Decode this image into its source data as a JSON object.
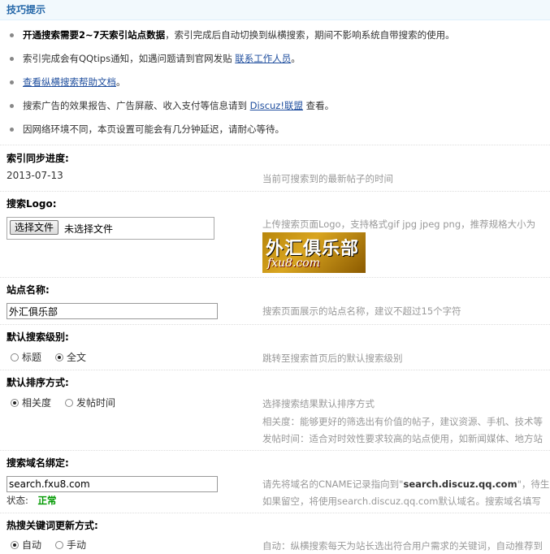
{
  "tips_panel": {
    "title": "技巧提示",
    "items": [
      {
        "bold": "开通搜索需要2~7天索引站点数据",
        "text": "，索引完成后自动切换到纵横搜索，期间不影响系统自带搜索的使用。"
      },
      {
        "text": "索引完成会有QQtips通知，如遇问题请到官网发贴 ",
        "link": "联系工作人员",
        "after": "。"
      },
      {
        "link": "查看纵横搜索帮助文档",
        "after": "。"
      },
      {
        "text": "搜索广告的效果报告、广告屏蔽、收入支付等信息请到 ",
        "link": "Discuz!联盟",
        "after": " 查看。"
      },
      {
        "text": "因网络环境不同，本页设置可能会有几分钟延迟，请耐心等待。"
      }
    ]
  },
  "index_progress": {
    "label": "索引同步进度:",
    "value": "2013-07-13",
    "tip": "当前可搜索到的最新帖子的时间"
  },
  "search_logo": {
    "label": "搜索Logo:",
    "file_button": "选择文件",
    "file_status": "未选择文件",
    "tip": "上传搜索页面Logo，支持格式gif jpg jpeg png，推荐规格大小为",
    "logo_text_cn": "外汇俱乐部",
    "logo_text_en": "fxu8.com"
  },
  "site_name": {
    "label": "站点名称:",
    "value": "外汇俱乐部",
    "tip": "搜索页面展示的站点名称，建议不超过15个字符"
  },
  "default_level": {
    "label": "默认搜索级别:",
    "options": [
      "标题",
      "全文"
    ],
    "selected": "全文",
    "tip": "跳转至搜索首页后的默认搜索级别"
  },
  "default_sort": {
    "label": "默认排序方式:",
    "options": [
      "相关度",
      "发帖时间"
    ],
    "selected": "相关度",
    "tip": "选择搜索结果默认排序方式",
    "tip2": "相关度：能够更好的筛选出有价值的帖子，建议资源、手机、技术等",
    "tip3": "发帖时间：适合对时效性要求较高的站点使用，如新闻媒体、地方站"
  },
  "domain_bind": {
    "label": "搜索域名绑定:",
    "value": "search.fxu8.com",
    "status_label": "状态:",
    "status_value": "正常",
    "tip_pre": "请先将域名的CNAME记录指向到\"",
    "tip_bold": "search.discuz.qq.com",
    "tip_post": "\"，待生",
    "tip2": "如果留空，将使用search.discuz.qq.com默认域名。搜索域名填写"
  },
  "hot_keywords": {
    "label": "热搜关键词更新方式:",
    "options": [
      "自动",
      "手动"
    ],
    "selected": "自动",
    "tip": "自动：纵横搜索每天为站长选出符合用户需求的关键词，自动推荐到"
  }
}
